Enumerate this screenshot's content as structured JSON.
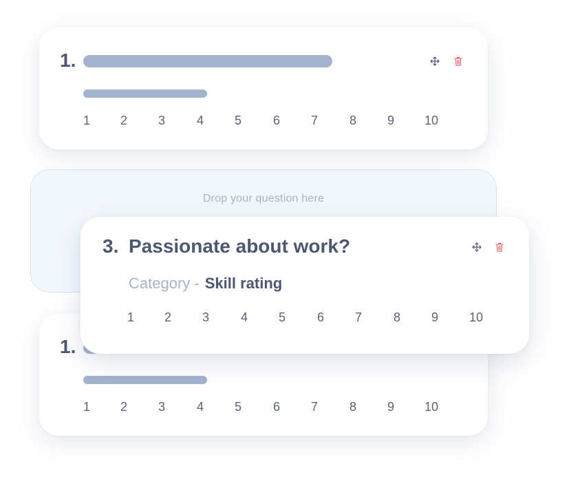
{
  "question_cards": [
    {
      "number": "1.",
      "scale": [
        "1",
        "2",
        "3",
        "4",
        "5",
        "6",
        "7",
        "8",
        "9",
        "10"
      ]
    },
    {
      "number": "1.",
      "scale": [
        "1",
        "2",
        "3",
        "4",
        "5",
        "6",
        "7",
        "8",
        "9",
        "10"
      ]
    }
  ],
  "drop_zone": {
    "text": "Drop your question here"
  },
  "dragged_card": {
    "number": "3.",
    "title": "Passionate about work?",
    "category_label": "Category -",
    "category_value": "Skill rating",
    "scale": [
      "1",
      "2",
      "3",
      "4",
      "5",
      "6",
      "7",
      "8",
      "9",
      "10"
    ]
  },
  "icons": {
    "move": "move-arrows-icon",
    "delete": "trash-icon"
  },
  "colors": {
    "text_dark": "#4d5770",
    "placeholder_bar": "#a3b2cd",
    "delete_red": "#e05a5a",
    "drop_zone_bg": "#f3f8fd"
  }
}
